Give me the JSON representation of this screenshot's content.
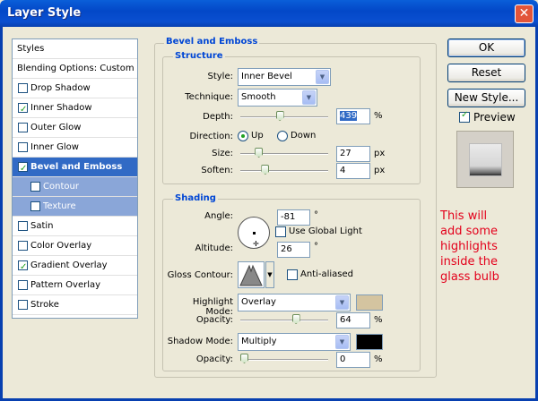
{
  "window": {
    "title": "Layer Style",
    "close_glyph": "✕"
  },
  "styles_list": {
    "header": "Styles",
    "blending": "Blending Options: Custom",
    "items": [
      {
        "label": "Drop Shadow",
        "checked": false
      },
      {
        "label": "Inner Shadow",
        "checked": true
      },
      {
        "label": "Outer Glow",
        "checked": false
      },
      {
        "label": "Inner Glow",
        "checked": false
      },
      {
        "label": "Bevel and Emboss",
        "checked": true,
        "selected": true
      },
      {
        "label": "Contour",
        "checked": false,
        "sub": true
      },
      {
        "label": "Texture",
        "checked": false,
        "sub": true
      },
      {
        "label": "Satin",
        "checked": false
      },
      {
        "label": "Color Overlay",
        "checked": false
      },
      {
        "label": "Gradient Overlay",
        "checked": true
      },
      {
        "label": "Pattern Overlay",
        "checked": false
      },
      {
        "label": "Stroke",
        "checked": false
      }
    ]
  },
  "bevel": {
    "section_title": "Bevel and Emboss",
    "structure": {
      "title": "Structure",
      "style_label": "Style:",
      "style_value": "Inner Bevel",
      "technique_label": "Technique:",
      "technique_value": "Smooth",
      "depth_label": "Depth:",
      "depth_value": "439",
      "depth_unit": "%",
      "depth_slider": 0.44,
      "direction_label": "Direction:",
      "direction_up": "Up",
      "direction_down": "Down",
      "direction_selected": "Up",
      "size_label": "Size:",
      "size_value": "27",
      "size_unit": "px",
      "size_slider": 0.18,
      "soften_label": "Soften:",
      "soften_value": "4",
      "soften_unit": "px",
      "soften_slider": 0.26
    },
    "shading": {
      "title": "Shading",
      "angle_label": "Angle:",
      "angle_value": "-81",
      "angle_unit": "°",
      "global_light_label": "Use Global Light",
      "global_light": false,
      "altitude_label": "Altitude:",
      "altitude_value": "26",
      "altitude_unit": "°",
      "gloss_label": "Gloss Contour:",
      "anti_aliased_label": "Anti-aliased",
      "anti_aliased": false,
      "highlight_mode_label": "Highlight Mode:",
      "highlight_mode_value": "Overlay",
      "highlight_color": "#d4c4a0",
      "highlight_opacity_label": "Opacity:",
      "highlight_opacity_value": "64",
      "highlight_opacity_unit": "%",
      "highlight_opacity_slider": 0.64,
      "shadow_mode_label": "Shadow Mode:",
      "shadow_mode_value": "Multiply",
      "shadow_color": "#000000",
      "shadow_opacity_label": "Opacity:",
      "shadow_opacity_value": "0",
      "shadow_opacity_unit": "%",
      "shadow_opacity_slider": 0.0
    }
  },
  "buttons": {
    "ok": "OK",
    "reset": "Reset",
    "new_style": "New Style...",
    "preview_label": "Preview",
    "preview": true
  },
  "annotation": {
    "line1": "This will",
    "line2": "add some",
    "line3": "highlights",
    "line4": "inside the",
    "line5": "glass bulb"
  }
}
